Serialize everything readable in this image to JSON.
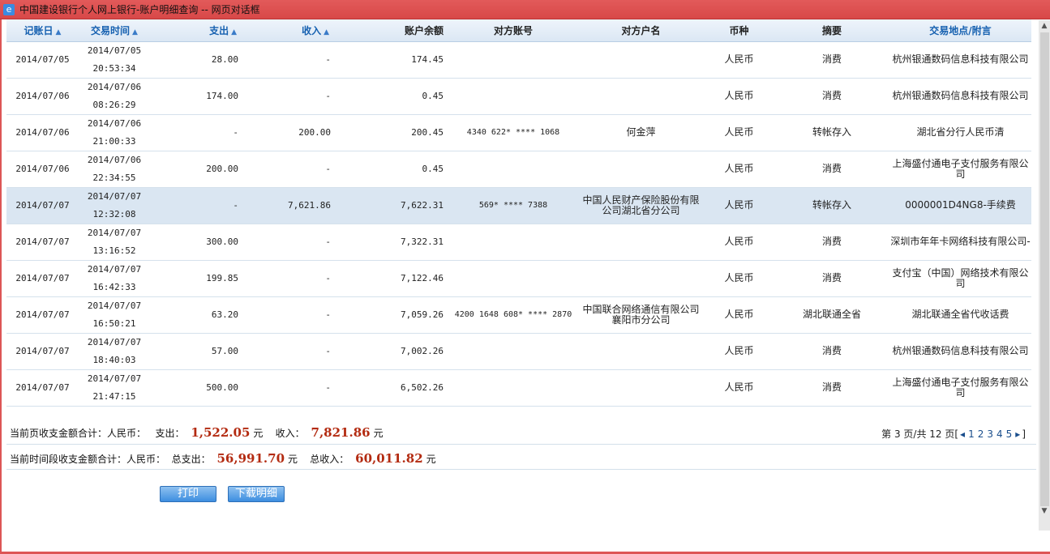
{
  "window": {
    "title": "中国建设银行个人网上银行-账户明细查询 -- 网页对话框"
  },
  "headers": [
    "记账日",
    "交易时间",
    "支出",
    "收入",
    "账户余额",
    "对方账号",
    "对方户名",
    "币种",
    "摘要",
    "交易地点/附言"
  ],
  "rows": [
    [
      "2014/07/05",
      "2014/07/05",
      "20:53:34",
      "28.00",
      "-",
      "174.45",
      "",
      "",
      "人民币",
      "消费",
      "杭州银通数码信息科技有限公司"
    ],
    [
      "2014/07/06",
      "2014/07/06",
      "08:26:29",
      "174.00",
      "-",
      "0.45",
      "",
      "",
      "人民币",
      "消费",
      "杭州银通数码信息科技有限公司"
    ],
    [
      "2014/07/06",
      "2014/07/06",
      "21:00:33",
      "-",
      "200.00",
      "200.45",
      "4340 622* **** 1068",
      "何金萍",
      "人民币",
      "转帐存入",
      "湖北省分行人民币清"
    ],
    [
      "2014/07/06",
      "2014/07/06",
      "22:34:55",
      "200.00",
      "-",
      "0.45",
      "",
      "",
      "人民币",
      "消费",
      "上海盛付通电子支付服务有限公司"
    ],
    [
      "2014/07/07",
      "2014/07/07",
      "12:32:08",
      "-",
      "7,621.86",
      "7,622.31",
      "569* **** 7388",
      "中国人民财产保险股份有限公司湖北省分公司",
      "人民币",
      "转帐存入",
      "0000001D4NG8-手续费"
    ],
    [
      "2014/07/07",
      "2014/07/07",
      "13:16:52",
      "300.00",
      "-",
      "7,322.31",
      "",
      "",
      "人民币",
      "消费",
      "深圳市年年卡网络科技有限公司-"
    ],
    [
      "2014/07/07",
      "2014/07/07",
      "16:42:33",
      "199.85",
      "-",
      "7,122.46",
      "",
      "",
      "人民币",
      "消费",
      "支付宝（中国）网络技术有限公司"
    ],
    [
      "2014/07/07",
      "2014/07/07",
      "16:50:21",
      "63.20",
      "-",
      "7,059.26",
      "4200 1648 608* **** 2870",
      "中国联合网络通信有限公司襄阳市分公司",
      "人民币",
      "湖北联通全省",
      "湖北联通全省代收话费"
    ],
    [
      "2014/07/07",
      "2014/07/07",
      "18:40:03",
      "57.00",
      "-",
      "7,002.26",
      "",
      "",
      "人民币",
      "消费",
      "杭州银通数码信息科技有限公司"
    ],
    [
      "2014/07/07",
      "2014/07/07",
      "21:47:15",
      "500.00",
      "-",
      "6,502.26",
      "",
      "",
      "人民币",
      "消费",
      "上海盛付通电子支付服务有限公司"
    ]
  ],
  "selected_row": 4,
  "page_summary": {
    "label": "当前页收支金额合计：人民币：",
    "out_label": "支出：",
    "out": "1,522.05",
    "in_label": "收入：",
    "in": "7,821.86",
    "unit": "元"
  },
  "period_summary": {
    "label": "当前时间段收支金额合计：人民币：",
    "out_label": "总支出：",
    "out": "56,991.70",
    "in_label": "总收入：",
    "in": "60,011.82",
    "unit": "元"
  },
  "pager": {
    "text": "第 3 页/共 12 页[",
    "pages": [
      "1",
      "2",
      "3",
      "4",
      "5"
    ],
    "close": "]"
  },
  "buttons": {
    "print": "打印",
    "download": "下载明细"
  },
  "colors": {
    "accent": "#1560b0",
    "amount": "#b32a10",
    "selected": "#dae6f2"
  }
}
